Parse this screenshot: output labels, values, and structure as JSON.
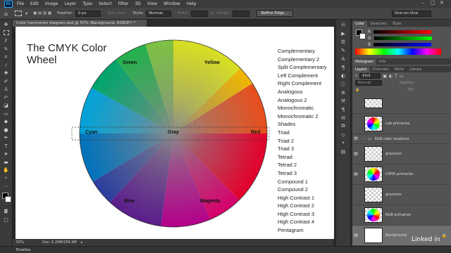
{
  "menubar": {
    "logo": "Ps",
    "items": [
      "File",
      "Edit",
      "Image",
      "Layer",
      "Type",
      "Select",
      "Filter",
      "3D",
      "View",
      "Window",
      "Help"
    ]
  },
  "options": {
    "feather_label": "Feather:",
    "feather_value": "0 px",
    "antialias_label": "Anti-alias",
    "style_label": "Style:",
    "style_value": "Normal",
    "width_label": "Width:",
    "height_label": "Height:",
    "refine_edge": "Refine Edge...",
    "workspace": "One-on-One"
  },
  "document": {
    "tab_title": "Color harmonies diagram.psd @ 55% (Background, RGB/8*) *",
    "zoom": "55%",
    "doc_info": "Doc: 6.29M/254.9M"
  },
  "canvas": {
    "title_line1": "The CMYK Color",
    "title_line2": "Wheel",
    "wheel_labels": {
      "green": "Green",
      "yellow": "Yellow",
      "cyan": "Cyan",
      "gray": "Gray",
      "red": "Red",
      "blue": "Blue",
      "magenta": "Magenta"
    },
    "harmonies": [
      "Complementary",
      "Complementary 2",
      "Split Complementary",
      "Left Complement",
      "Right Complement",
      "Analogous",
      "Analogous 2",
      "Monochromatic",
      "Monochromatic 2",
      "Shades",
      "Triad",
      "Triad 2",
      "Triad 3",
      "Tetrad",
      "Tetrad 2",
      "Tetrad 3",
      "Compound 1",
      "Compound 2",
      "High Contrast 1",
      "High Contrast 2",
      "High Contrast 3",
      "High Contrast 4",
      "Pentagram"
    ]
  },
  "color_panel": {
    "tabs": [
      "Color",
      "Swatches",
      "Style"
    ],
    "sliders": [
      "R",
      "G",
      "B"
    ]
  },
  "histogram_tabs": [
    "Histogram",
    "Info"
  ],
  "layers_panel": {
    "tabs": [
      "Layers",
      "Channels",
      "Paths",
      "Library"
    ],
    "kind_label": "Kind",
    "blend_mode": "Normal",
    "opacity_label": "Opacity:",
    "fill_label": "Fill:",
    "layers": [
      {
        "name": "",
        "thumb": "gray",
        "visible": false
      },
      {
        "name": "Lab primaries",
        "thumb": "wheel",
        "visible": false
      },
      {
        "name": "RGB color locations",
        "thumb": "folder",
        "visible": true
      },
      {
        "name": "grayness",
        "thumb": "gray",
        "visible": true
      },
      {
        "name": "CMYK primaries",
        "thumb": "wheel",
        "visible": true
      },
      {
        "name": "grayness",
        "thumb": "gray",
        "visible": false
      },
      {
        "name": "RGB primaries",
        "thumb": "wheel",
        "visible": false
      },
      {
        "name": "Background",
        "thumb": "white",
        "visible": true
      }
    ]
  },
  "timeline_label": "Timeline",
  "watermark": "Linked in",
  "colors": {
    "chrome": "#535353",
    "accent": "#31a8ff"
  }
}
